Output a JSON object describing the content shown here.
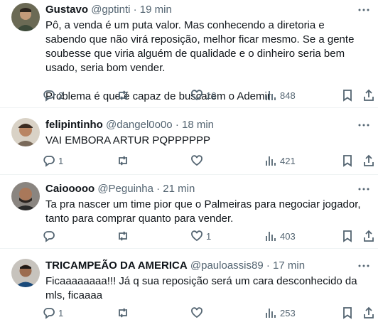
{
  "tweets": [
    {
      "name": "Gustavo",
      "handle": "@gptinti",
      "separator": "·",
      "time": "19 min",
      "text": "Pô, a venda é um puta valor. Mas conhecendo a diretoria e sabendo que não virá reposição, melhor ficar mesmo. Se a gente soubesse que viria alguém de qualidade e o dinheiro seria bem usado, seria bom vender.\n\nProblema é que é capaz de buscarem o Ademir",
      "replies": "2",
      "retweets": "",
      "likes": "16",
      "views": "848"
    },
    {
      "name": "felipintinho",
      "handle": "@dangel0o0o",
      "separator": "·",
      "time": "18 min",
      "text": "VAI EMBORA ARTUR PQPPPPPP",
      "replies": "1",
      "retweets": "",
      "likes": "",
      "views": "421"
    },
    {
      "name": "Caiooooo",
      "handle": "@Peguinha",
      "separator": "·",
      "time": "21 min",
      "text": "Ta pra nascer um time pior que o Palmeiras para negociar jogador, tanto para comprar quanto para vender.",
      "replies": "",
      "retweets": "",
      "likes": "1",
      "views": "403"
    },
    {
      "name": "TRICAMPEÃO DA AMERICA",
      "handle": "@pauloassis89",
      "separator": "·",
      "time": "17 min",
      "text": "Ficaaaaaaaa!!! Já q sua reposição será um cara desconhecido da mls, ficaaaa",
      "replies": "1",
      "retweets": "",
      "likes": "",
      "views": "253"
    }
  ],
  "icons": {
    "reply": "reply-icon",
    "retweet": "retweet-icon",
    "like": "heart-icon",
    "views": "views-icon",
    "bookmark": "bookmark-icon",
    "share": "share-icon",
    "more": "more-icon"
  },
  "colors": {
    "text_primary": "#0f1419",
    "text_secondary": "#536471",
    "divider": "#eff3f4"
  }
}
